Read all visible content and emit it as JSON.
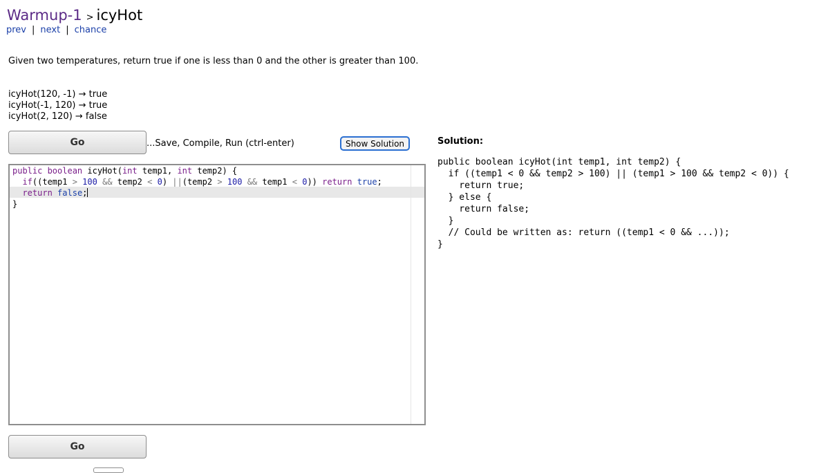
{
  "breadcrumb": {
    "section": "Warmup-1",
    "separator": ">",
    "title": "icyHot"
  },
  "nav": {
    "prev": "prev",
    "next": "next",
    "chance": "chance",
    "divider": "|"
  },
  "problem": {
    "prompt": "Given two temperatures, return true if one is less than 0 and the other is greater than 100.",
    "examples": [
      "icyHot(120, -1) → true",
      "icyHot(-1, 120) → true",
      "icyHot(2, 120) → false"
    ]
  },
  "controls": {
    "go_label": "Go",
    "run_note": "...Save, Compile, Run (ctrl-enter)",
    "show_solution_label": "Show Solution"
  },
  "editor": {
    "lines": [
      "public boolean icyHot(int temp1, int temp2) {",
      "  if((temp1 > 100 && temp2 < 0) ||(temp2 > 100 && temp1 < 0)) return true;",
      "  return false;",
      "}"
    ]
  },
  "solution": {
    "label": "Solution:",
    "code": "public boolean icyHot(int temp1, int temp2) {\n  if ((temp1 < 0 && temp2 > 100) || (temp1 > 100 && temp2 < 0)) {\n    return true;\n  } else {\n    return false;\n  }\n  // Could be written as: return ((temp1 < 0 && ...));\n}"
  },
  "colors": {
    "section_link": "#5b2a86",
    "nav_link": "#1a3fa8",
    "keyword": "#7a1e8a",
    "number": "#1a1aa6",
    "focus_ring": "#2a6fd1"
  }
}
